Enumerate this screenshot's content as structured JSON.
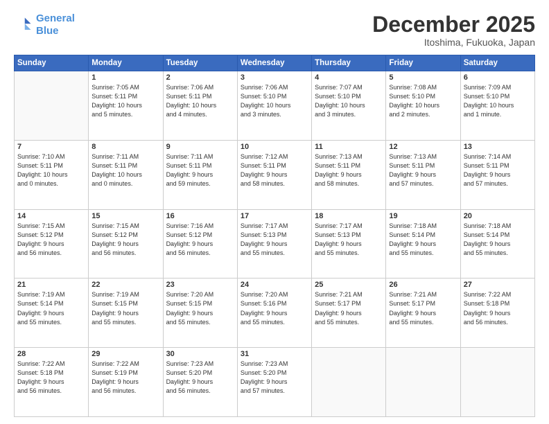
{
  "header": {
    "logo_line1": "General",
    "logo_line2": "Blue",
    "month": "December 2025",
    "location": "Itoshima, Fukuoka, Japan"
  },
  "weekdays": [
    "Sunday",
    "Monday",
    "Tuesday",
    "Wednesday",
    "Thursday",
    "Friday",
    "Saturday"
  ],
  "weeks": [
    [
      {
        "day": "",
        "info": ""
      },
      {
        "day": "1",
        "info": "Sunrise: 7:05 AM\nSunset: 5:11 PM\nDaylight: 10 hours\nand 5 minutes."
      },
      {
        "day": "2",
        "info": "Sunrise: 7:06 AM\nSunset: 5:11 PM\nDaylight: 10 hours\nand 4 minutes."
      },
      {
        "day": "3",
        "info": "Sunrise: 7:06 AM\nSunset: 5:10 PM\nDaylight: 10 hours\nand 3 minutes."
      },
      {
        "day": "4",
        "info": "Sunrise: 7:07 AM\nSunset: 5:10 PM\nDaylight: 10 hours\nand 3 minutes."
      },
      {
        "day": "5",
        "info": "Sunrise: 7:08 AM\nSunset: 5:10 PM\nDaylight: 10 hours\nand 2 minutes."
      },
      {
        "day": "6",
        "info": "Sunrise: 7:09 AM\nSunset: 5:10 PM\nDaylight: 10 hours\nand 1 minute."
      }
    ],
    [
      {
        "day": "7",
        "info": "Sunrise: 7:10 AM\nSunset: 5:11 PM\nDaylight: 10 hours\nand 0 minutes."
      },
      {
        "day": "8",
        "info": "Sunrise: 7:11 AM\nSunset: 5:11 PM\nDaylight: 10 hours\nand 0 minutes."
      },
      {
        "day": "9",
        "info": "Sunrise: 7:11 AM\nSunset: 5:11 PM\nDaylight: 9 hours\nand 59 minutes."
      },
      {
        "day": "10",
        "info": "Sunrise: 7:12 AM\nSunset: 5:11 PM\nDaylight: 9 hours\nand 58 minutes."
      },
      {
        "day": "11",
        "info": "Sunrise: 7:13 AM\nSunset: 5:11 PM\nDaylight: 9 hours\nand 58 minutes."
      },
      {
        "day": "12",
        "info": "Sunrise: 7:13 AM\nSunset: 5:11 PM\nDaylight: 9 hours\nand 57 minutes."
      },
      {
        "day": "13",
        "info": "Sunrise: 7:14 AM\nSunset: 5:11 PM\nDaylight: 9 hours\nand 57 minutes."
      }
    ],
    [
      {
        "day": "14",
        "info": "Sunrise: 7:15 AM\nSunset: 5:12 PM\nDaylight: 9 hours\nand 56 minutes."
      },
      {
        "day": "15",
        "info": "Sunrise: 7:15 AM\nSunset: 5:12 PM\nDaylight: 9 hours\nand 56 minutes."
      },
      {
        "day": "16",
        "info": "Sunrise: 7:16 AM\nSunset: 5:12 PM\nDaylight: 9 hours\nand 56 minutes."
      },
      {
        "day": "17",
        "info": "Sunrise: 7:17 AM\nSunset: 5:13 PM\nDaylight: 9 hours\nand 55 minutes."
      },
      {
        "day": "18",
        "info": "Sunrise: 7:17 AM\nSunset: 5:13 PM\nDaylight: 9 hours\nand 55 minutes."
      },
      {
        "day": "19",
        "info": "Sunrise: 7:18 AM\nSunset: 5:14 PM\nDaylight: 9 hours\nand 55 minutes."
      },
      {
        "day": "20",
        "info": "Sunrise: 7:18 AM\nSunset: 5:14 PM\nDaylight: 9 hours\nand 55 minutes."
      }
    ],
    [
      {
        "day": "21",
        "info": "Sunrise: 7:19 AM\nSunset: 5:14 PM\nDaylight: 9 hours\nand 55 minutes."
      },
      {
        "day": "22",
        "info": "Sunrise: 7:19 AM\nSunset: 5:15 PM\nDaylight: 9 hours\nand 55 minutes."
      },
      {
        "day": "23",
        "info": "Sunrise: 7:20 AM\nSunset: 5:15 PM\nDaylight: 9 hours\nand 55 minutes."
      },
      {
        "day": "24",
        "info": "Sunrise: 7:20 AM\nSunset: 5:16 PM\nDaylight: 9 hours\nand 55 minutes."
      },
      {
        "day": "25",
        "info": "Sunrise: 7:21 AM\nSunset: 5:17 PM\nDaylight: 9 hours\nand 55 minutes."
      },
      {
        "day": "26",
        "info": "Sunrise: 7:21 AM\nSunset: 5:17 PM\nDaylight: 9 hours\nand 55 minutes."
      },
      {
        "day": "27",
        "info": "Sunrise: 7:22 AM\nSunset: 5:18 PM\nDaylight: 9 hours\nand 56 minutes."
      }
    ],
    [
      {
        "day": "28",
        "info": "Sunrise: 7:22 AM\nSunset: 5:18 PM\nDaylight: 9 hours\nand 56 minutes."
      },
      {
        "day": "29",
        "info": "Sunrise: 7:22 AM\nSunset: 5:19 PM\nDaylight: 9 hours\nand 56 minutes."
      },
      {
        "day": "30",
        "info": "Sunrise: 7:23 AM\nSunset: 5:20 PM\nDaylight: 9 hours\nand 56 minutes."
      },
      {
        "day": "31",
        "info": "Sunrise: 7:23 AM\nSunset: 5:20 PM\nDaylight: 9 hours\nand 57 minutes."
      },
      {
        "day": "",
        "info": ""
      },
      {
        "day": "",
        "info": ""
      },
      {
        "day": "",
        "info": ""
      }
    ]
  ]
}
